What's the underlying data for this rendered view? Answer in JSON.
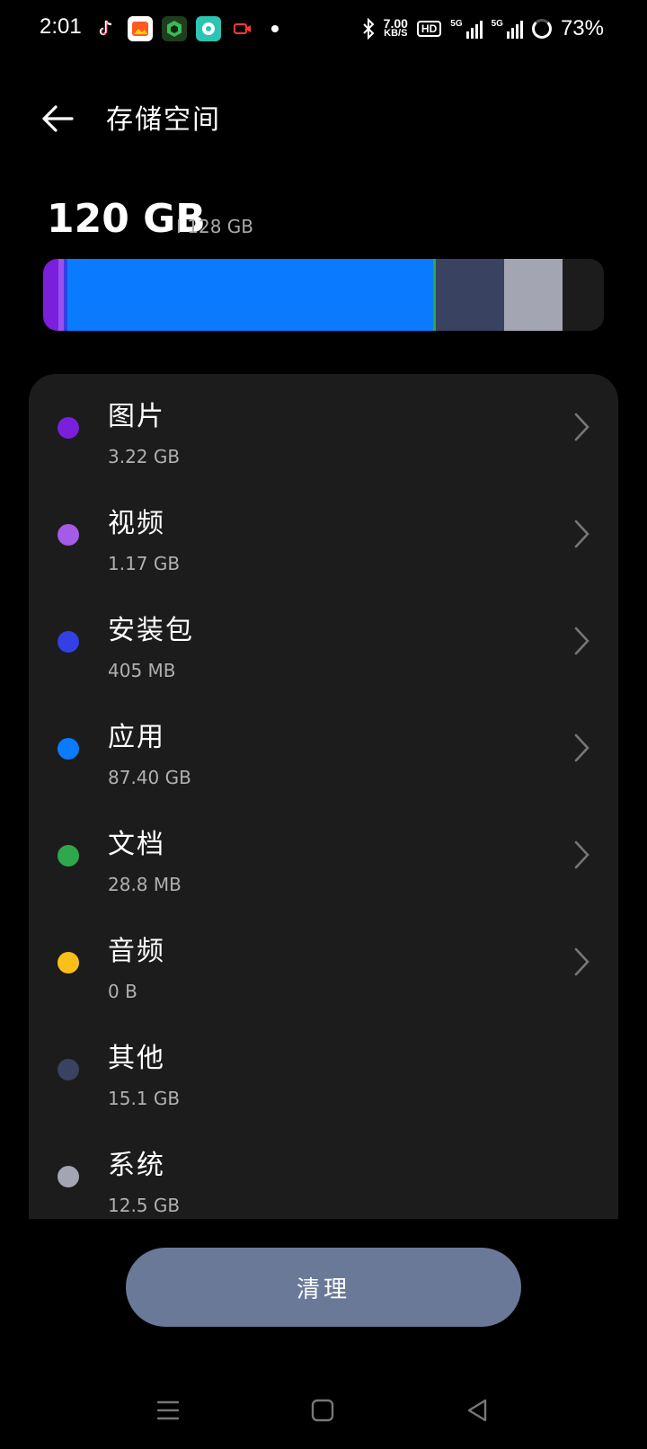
{
  "status_bar": {
    "time": "2:01",
    "speed_value": "7.00",
    "speed_unit": "KB/S",
    "hd": "HD",
    "sim1": "5G",
    "sim2": "5G",
    "battery": "73%"
  },
  "header": {
    "title": "存储空间"
  },
  "storage": {
    "used": "120 GB",
    "capacity": "I 128 GB"
  },
  "usage_bar": [
    {
      "label": "图片",
      "fraction": 0.027,
      "color": "#7a1fdc"
    },
    {
      "label": "视频",
      "fraction": 0.01,
      "color": "#9a4ff0"
    },
    {
      "label": "安装包",
      "fraction": 0.006,
      "color": "#3240e6"
    },
    {
      "label": "应用",
      "fraction": 0.652,
      "color": "#0a7bff"
    },
    {
      "label": "文档",
      "fraction": 0.005,
      "color": "#2ea84a"
    },
    {
      "label": "其他",
      "fraction": 0.122,
      "color": "#3a4261"
    },
    {
      "label": "系统",
      "fraction": 0.104,
      "color": "#a3a5b3"
    }
  ],
  "categories": [
    {
      "name": "图片",
      "size": "3.22 GB",
      "color": "#7a1fdc",
      "chevron": true
    },
    {
      "name": "视频",
      "size": "1.17 GB",
      "color": "#a45be8",
      "chevron": true
    },
    {
      "name": "安装包",
      "size": "405 MB",
      "color": "#3240e6",
      "chevron": true
    },
    {
      "name": "应用",
      "size": "87.40  GB",
      "color": "#0a7bff",
      "chevron": true
    },
    {
      "name": "文档",
      "size": "28.8 MB",
      "color": "#2ea84a",
      "chevron": true
    },
    {
      "name": "音频",
      "size": "0 B",
      "color": "#fbbf1a",
      "chevron": true
    },
    {
      "name": "其他",
      "size": "15.1 GB",
      "color": "#3a4261",
      "chevron": false
    },
    {
      "name": "系统",
      "size": "12.5 GB",
      "color": "#a3a5b3",
      "chevron": false
    }
  ],
  "actions": {
    "clean_label": "清理"
  }
}
